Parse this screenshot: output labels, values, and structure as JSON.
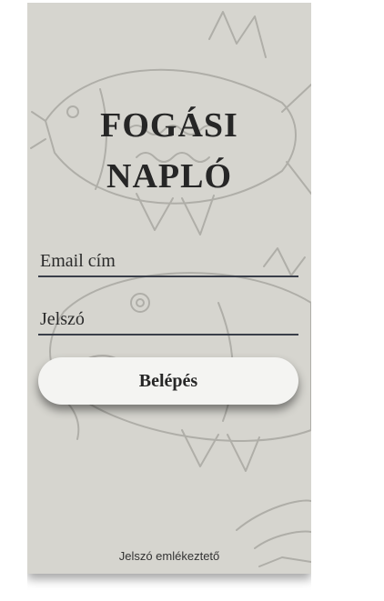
{
  "app": {
    "title_line1": "FOGÁSI",
    "title_line2": "NAPLÓ"
  },
  "form": {
    "email_placeholder": "Email cím",
    "email_value": "",
    "password_placeholder": "Jelszó",
    "password_value": "",
    "login_label": "Belépés",
    "reminder_label": "Jelszó emlékeztető"
  },
  "colors": {
    "panel_background": "#d6d5cf",
    "text": "#262626",
    "underline": "#3a3f4a",
    "button_background": "#f4f4f2"
  },
  "icons": {
    "background": "fish-illustration"
  }
}
